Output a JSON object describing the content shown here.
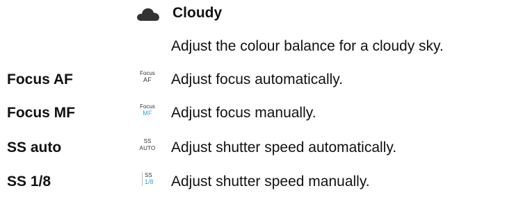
{
  "colors": {
    "text": "#111111",
    "icon_gray": "#333333",
    "icon_accent": "#29a9e0"
  },
  "cloudy": {
    "icon": "cloud-icon",
    "title": "Cloudy",
    "description": "Adjust the colour balance for a cloudy sky."
  },
  "rows": [
    {
      "term": "Focus AF",
      "icon_top": "Focus",
      "icon_bottom": "AF",
      "description": "Adjust focus automatically."
    },
    {
      "term": "Focus MF",
      "icon_top": "Focus",
      "icon_bottom": "MF",
      "description": "Adjust focus manually."
    },
    {
      "term": "SS auto",
      "icon_top": "SS",
      "icon_bottom": "AUTO",
      "description": "Adjust shutter speed automatically."
    },
    {
      "term": "SS 1/8",
      "icon_top": "SS",
      "icon_bottom": "1/8",
      "description": "Adjust shutter speed manually."
    }
  ]
}
